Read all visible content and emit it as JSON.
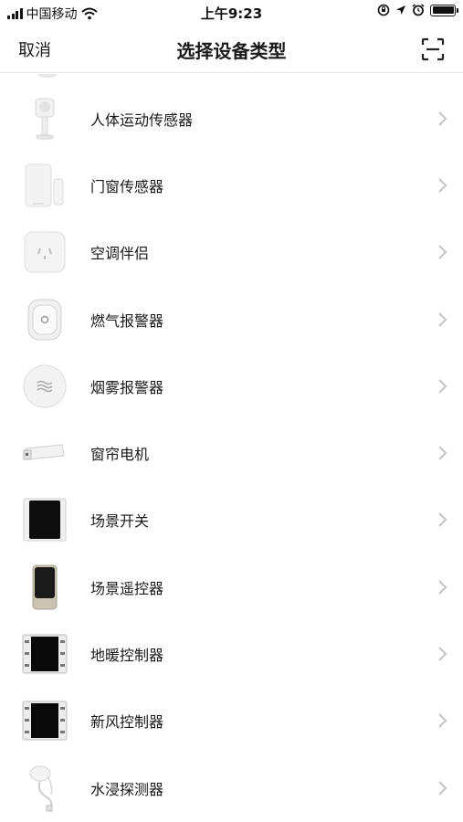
{
  "status_bar": {
    "carrier": "中国移动",
    "time": "上午9:23",
    "icons": [
      "signal-icon",
      "wifi-icon",
      "orientation-lock-icon",
      "location-icon",
      "alarm-icon",
      "battery-icon"
    ]
  },
  "nav": {
    "cancel_label": "取消",
    "title": "选择设备类型",
    "scan_icon": "scan-icon"
  },
  "devices": [
    {
      "label": "人体运动传感器",
      "icon": "motion-sensor-icon"
    },
    {
      "label": "门窗传感器",
      "icon": "door-window-sensor-icon"
    },
    {
      "label": "空调伴侣",
      "icon": "ac-companion-icon"
    },
    {
      "label": "燃气报警器",
      "icon": "gas-alarm-icon"
    },
    {
      "label": "烟雾报警器",
      "icon": "smoke-alarm-icon"
    },
    {
      "label": "窗帘电机",
      "icon": "curtain-motor-icon"
    },
    {
      "label": "场景开关",
      "icon": "scene-switch-icon"
    },
    {
      "label": "场景遥控器",
      "icon": "scene-remote-icon"
    },
    {
      "label": "地暖控制器",
      "icon": "floor-heating-controller-icon"
    },
    {
      "label": "新风控制器",
      "icon": "fresh-air-controller-icon"
    },
    {
      "label": "水浸探测器",
      "icon": "water-leak-detector-icon"
    }
  ]
}
